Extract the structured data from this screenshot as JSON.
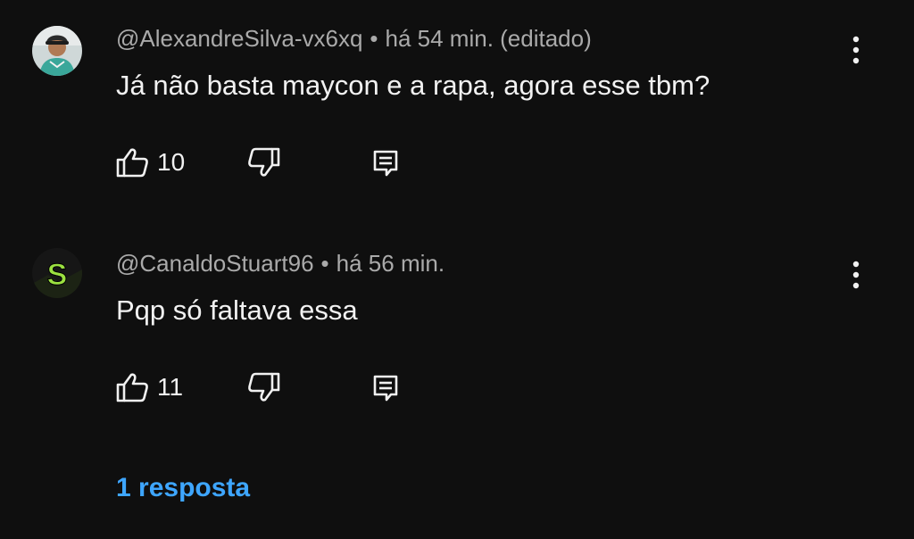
{
  "comments": [
    {
      "author": "@AlexandreSilva-vx6xq",
      "time": "há 54 min. (editado)",
      "text": "Já não basta maycon e a rapa, agora esse tbm?",
      "likes": "10"
    },
    {
      "author": "@CanaldoStuart96",
      "time": "há 56 min.",
      "text": "Pqp só faltava essa",
      "likes": "11",
      "avatar_letter": "S"
    }
  ],
  "separator": "•",
  "replies_link": "1 resposta",
  "colors": {
    "background": "#0f0f0f",
    "text": "#f1f1f1",
    "meta": "#aaaaaa",
    "link": "#3ea6ff",
    "avatar_accent": "#9be040"
  },
  "icons": [
    "thumbs-up-icon",
    "thumbs-down-icon",
    "reply-icon",
    "more-vert-icon"
  ]
}
